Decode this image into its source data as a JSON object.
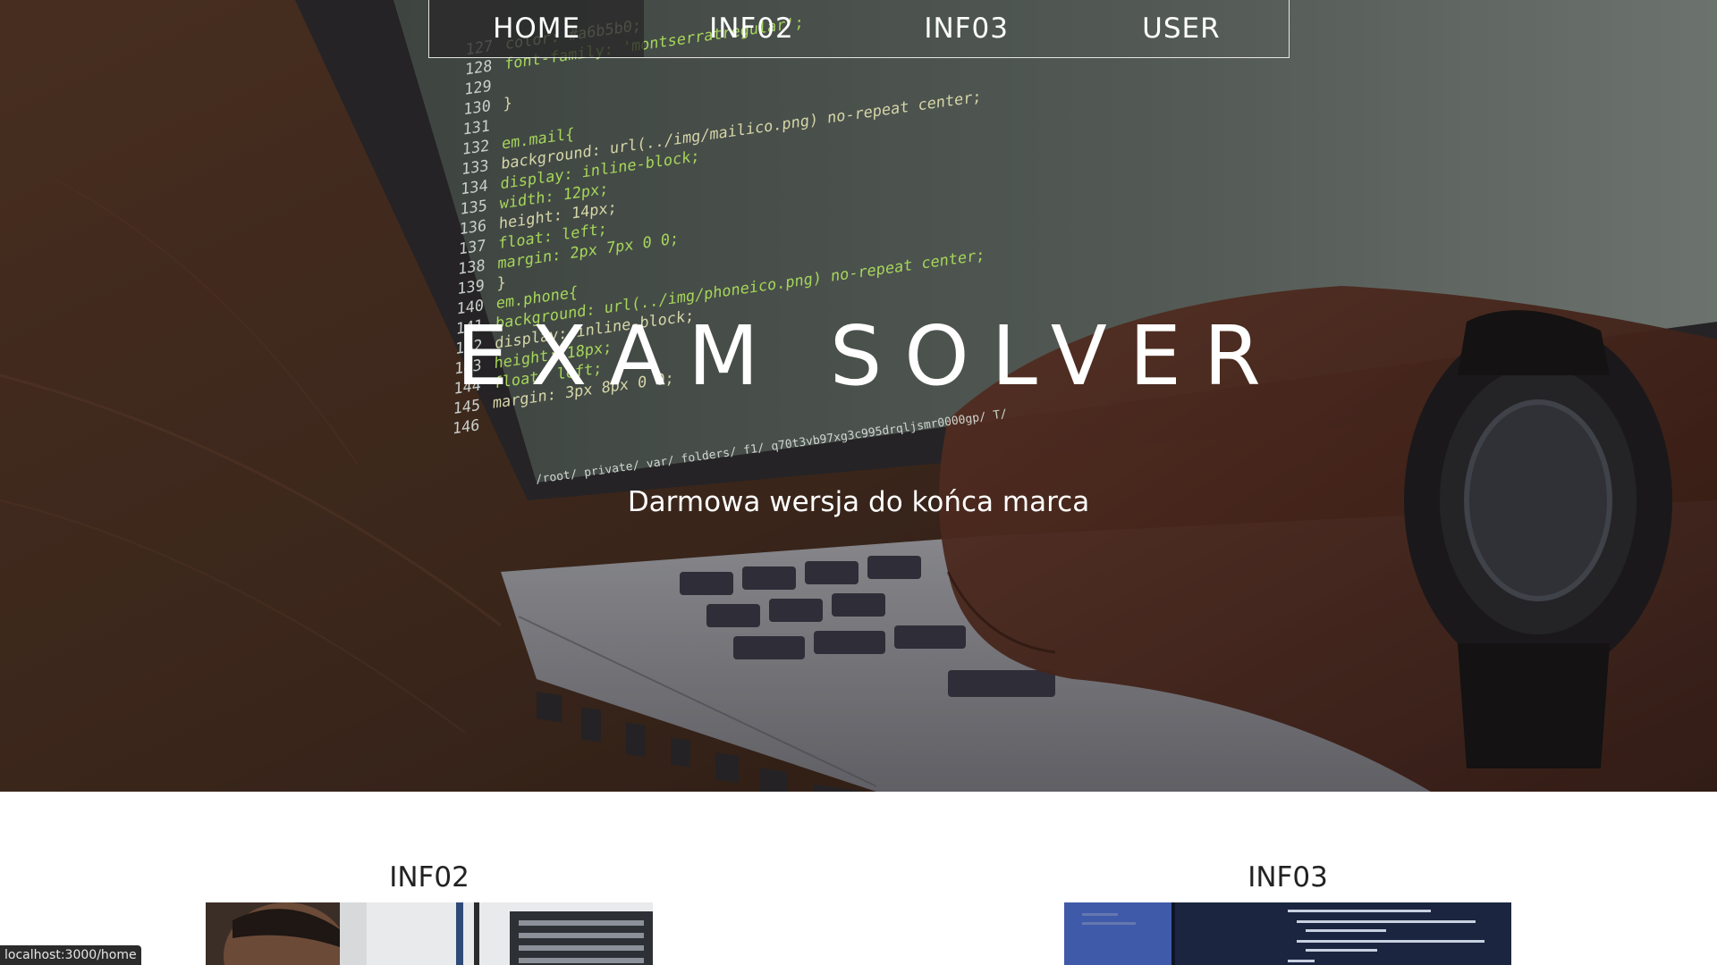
{
  "nav": {
    "items": [
      {
        "label": "HOME",
        "active": true
      },
      {
        "label": "INF02",
        "active": false
      },
      {
        "label": "INF03",
        "active": false
      },
      {
        "label": "USER",
        "active": false
      }
    ]
  },
  "hero": {
    "title": "EXAM SOLVER",
    "subtitle": "Darmowa wersja do końca marca",
    "code_lines": [
      {
        "num": "127",
        "text": "color: #a6b5b0;"
      },
      {
        "num": "128",
        "text": "font-family: 'montserratregular';"
      },
      {
        "num": "129",
        "text": ""
      },
      {
        "num": "130",
        "text": "}"
      },
      {
        "num": "131",
        "text": ""
      },
      {
        "num": "132",
        "text": "em.mail{"
      },
      {
        "num": "133",
        "text": "background: url(../img/mailico.png) no-repeat center;"
      },
      {
        "num": "134",
        "text": "display: inline-block;"
      },
      {
        "num": "135",
        "text": "width: 12px;"
      },
      {
        "num": "136",
        "text": "height: 14px;"
      },
      {
        "num": "137",
        "text": "float: left;"
      },
      {
        "num": "138",
        "text": "margin: 2px 7px 0 0;"
      },
      {
        "num": "139",
        "text": "}"
      },
      {
        "num": "140",
        "text": "em.phone{"
      },
      {
        "num": "141",
        "text": "background: url(../img/phoneico.png) no-repeat center;"
      },
      {
        "num": "142",
        "text": "display: inline-block;"
      },
      {
        "num": "143",
        "text": "height: 18px;"
      },
      {
        "num": "144",
        "text": "float: left;"
      },
      {
        "num": "145",
        "text": "margin: 3px 8px 0 0;"
      },
      {
        "num": "146",
        "text": ""
      }
    ],
    "path_text": "/root/ private/ var/ folders/ f1/ q70t3vb97xg3c995drqljsmr0000gp/ T/"
  },
  "cards": [
    {
      "title": "INF02",
      "image": "person-server-room-photo"
    },
    {
      "title": "INF03",
      "image": "code-screen-photo"
    }
  ],
  "status_bar": {
    "url": "localhost:3000/home"
  },
  "colors": {
    "overlay": "#2a1d17",
    "nav_active_bg": "#282828",
    "hero_text": "#ffffff",
    "card_title": "#222222",
    "code_keyword": "#d6d6a8",
    "code_value": "#a6d65a"
  }
}
